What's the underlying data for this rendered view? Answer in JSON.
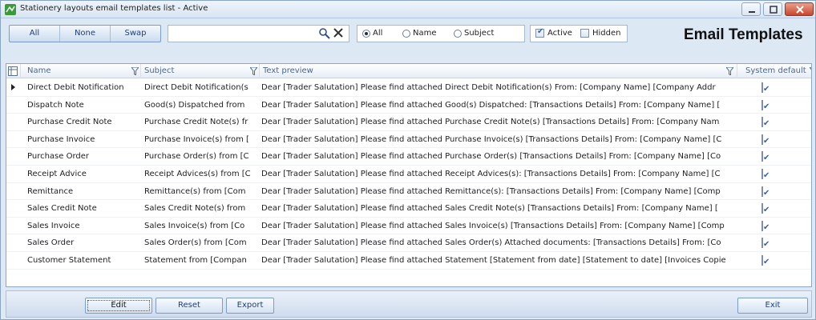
{
  "window": {
    "title": "Stationery layouts email templates list - Active"
  },
  "toolbar": {
    "all_label": "All",
    "none_label": "None",
    "swap_label": "Swap",
    "search_value": "",
    "radio_all": "All",
    "radio_name": "Name",
    "radio_subject": "Subject",
    "selected_radio": "All",
    "active_label": "Active",
    "active_checked": true,
    "hidden_label": "Hidden",
    "hidden_checked": false,
    "heading": "Email Templates"
  },
  "grid": {
    "columns": [
      "Name",
      "Subject",
      "Text preview",
      "System default"
    ],
    "rows": [
      {
        "name": "Direct Debit Notification",
        "subject": "Direct Debit Notification(s",
        "preview": "Dear [Trader Salutation]  Please find attached Direct Debit Notification(s)  From: [Company Name] [Company Addr",
        "system_default": true
      },
      {
        "name": "Dispatch Note",
        "subject": "Good(s) Dispatched from",
        "preview": "Dear [Trader Salutation]  Please find attached Good(s) Dispatched:  [Transactions Details]  From: [Company Name] [",
        "system_default": true
      },
      {
        "name": "Purchase Credit Note",
        "subject": "Purchase Credit Note(s) fr",
        "preview": "Dear [Trader Salutation]  Please find attached Purchase Credit Note(s) [Transactions Details]  From: [Company Nam",
        "system_default": true
      },
      {
        "name": "Purchase Invoice",
        "subject": "Purchase Invoice(s) from [",
        "preview": "Dear [Trader Salutation]  Please find attached Purchase Invoice(s) [Transactions Details]  From: [Company Name] [C",
        "system_default": true
      },
      {
        "name": "Purchase Order",
        "subject": "Purchase Order(s) from [C",
        "preview": "Dear [Trader Salutation]  Please find attached Purchase Order(s) [Transactions Details]  From: [Company Name] [Co",
        "system_default": true
      },
      {
        "name": "Receipt Advice",
        "subject": "Receipt Advices(s) from [C",
        "preview": "Dear [Trader Salutation]  Please find attached Receipt Advices(s):  [Transactions Details]  From: [Company Name] [C",
        "system_default": true
      },
      {
        "name": "Remittance",
        "subject": "Remittance(s) from [Com",
        "preview": "Dear [Trader Salutation]  Please find attached Remittance(s):  [Transactions Details]  From: [Company Name] [Comp",
        "system_default": true
      },
      {
        "name": "Sales Credit Note",
        "subject": "Sales Credit Note(s) from",
        "preview": "Dear [Trader Salutation]  Please find  attached Sales Credit Note(s) [Transactions Details]  From: [Company Name] [",
        "system_default": true
      },
      {
        "name": "Sales Invoice",
        "subject": "Sales Invoice(s) from [Co",
        "preview": "Dear [Trader Salutation]  Please find attached Sales Invoice(s) [Transactions Details]  From: [Company Name] [Comp",
        "system_default": true
      },
      {
        "name": "Sales Order",
        "subject": "Sales Order(s) from [Com",
        "preview": "Dear [Trader Salutation]  Please find attached Sales Order(s)  Attached documents: [Transactions Details]  From: [Co",
        "system_default": true
      },
      {
        "name": "Customer Statement",
        "subject": "Statement from [Compan",
        "preview": "Dear [Trader Salutation]  Please find attached Statement [Statement from date] [Statement to date] [Invoices Copie",
        "system_default": true
      }
    ]
  },
  "footer": {
    "edit_label": "Edit",
    "reset_label": "Reset",
    "export_label": "Export",
    "exit_label": "Exit"
  }
}
